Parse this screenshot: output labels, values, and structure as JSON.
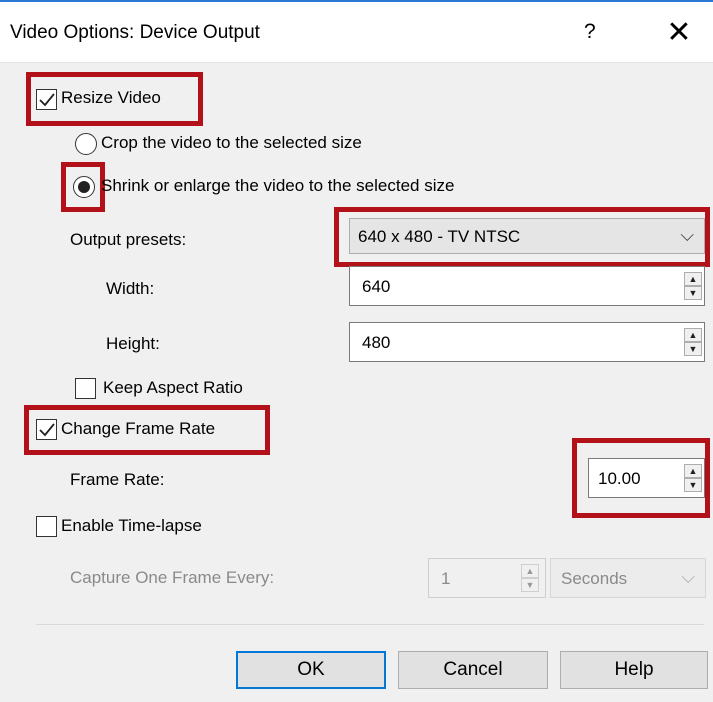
{
  "dialog": {
    "title": "Video Options: Device Output",
    "help_label": "?",
    "close_label": "✕"
  },
  "resize": {
    "checkbox_label": "Resize Video",
    "checked": true,
    "crop_label": "Crop the video to the selected size",
    "shrink_label": "Shrink or enlarge the video to the selected size",
    "selected_option": "shrink"
  },
  "output": {
    "presets_label": "Output presets:",
    "preset_value": "640 x 480 - TV NTSC",
    "width_label": "Width:",
    "width_value": "640",
    "height_label": "Height:",
    "height_value": "480",
    "keep_aspect_label": "Keep Aspect Ratio",
    "keep_aspect_checked": false
  },
  "frame_rate": {
    "checkbox_label": "Change Frame Rate",
    "checked": true,
    "label": "Frame Rate:",
    "value": "10.00"
  },
  "timelapse": {
    "checkbox_label": "Enable Time-lapse",
    "checked": false,
    "capture_label": "Capture One Frame Every:",
    "interval_value": "1",
    "unit_value": "Seconds"
  },
  "buttons": {
    "ok": "OK",
    "cancel": "Cancel",
    "help": "Help"
  },
  "colors": {
    "highlight": "#b3111a",
    "accent": "#0078d7"
  }
}
